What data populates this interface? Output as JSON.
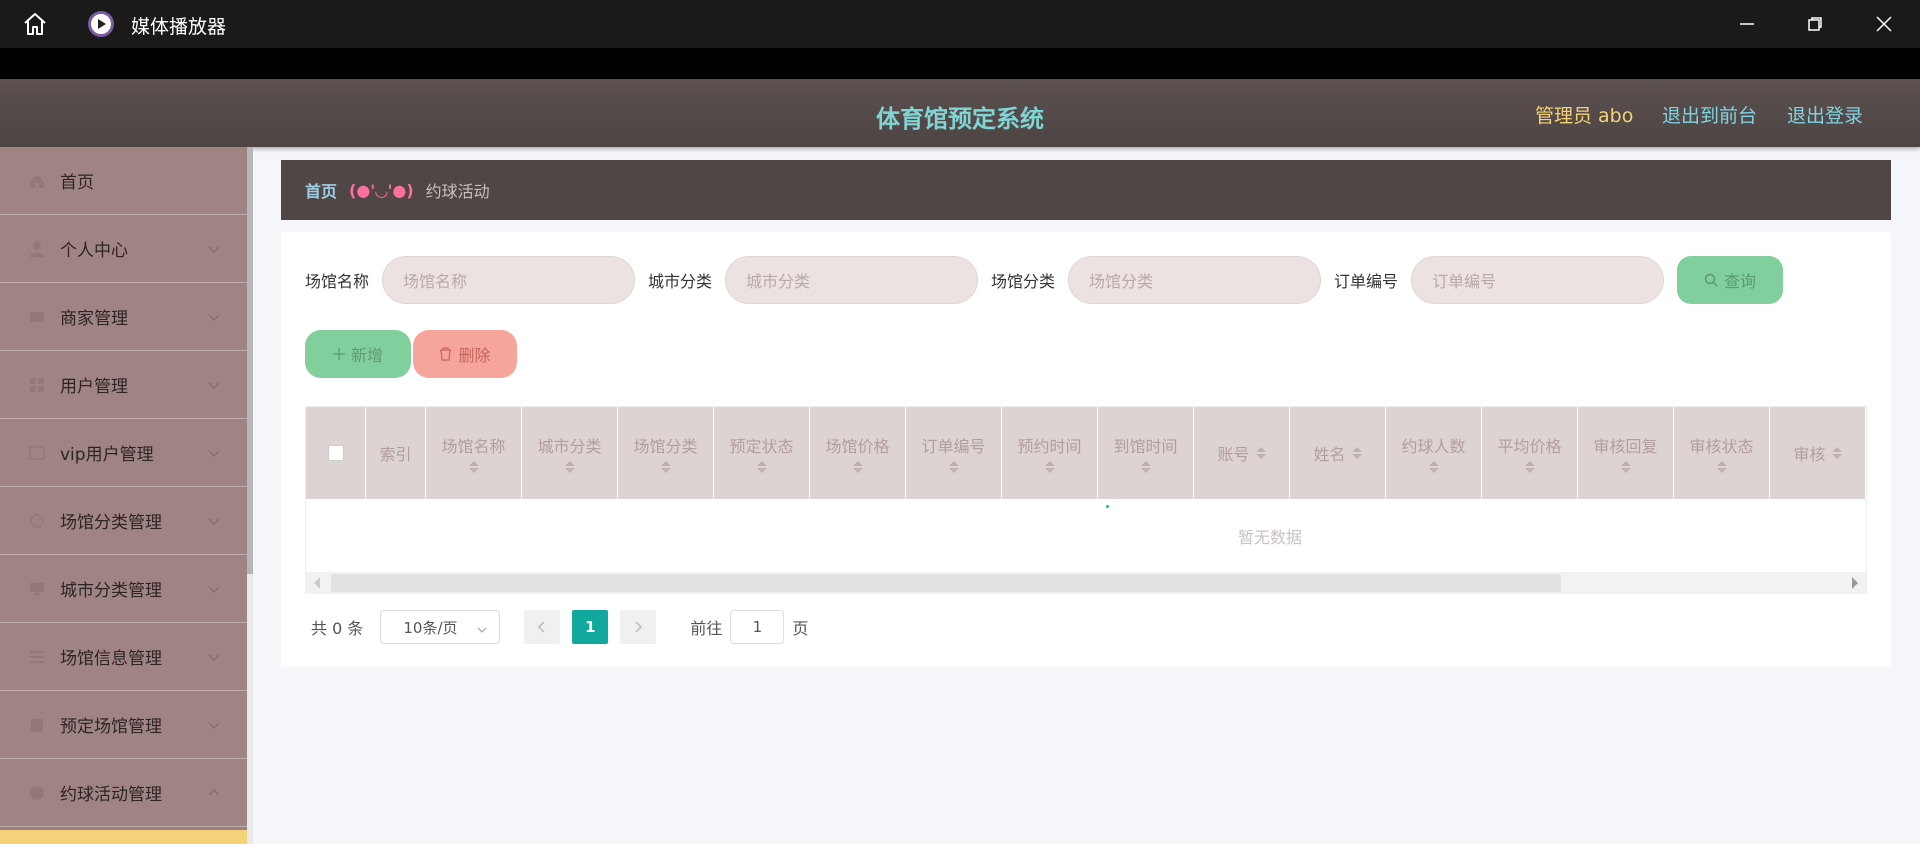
{
  "window": {
    "title": "媒体播放器",
    "icons": [
      "home-icon",
      "play-icon",
      "minimize-icon",
      "restore-icon",
      "close-icon"
    ]
  },
  "header": {
    "system_title": "体育馆预定系统",
    "admin_label": "管理员 abo",
    "front_link": "退出到前台",
    "logout_link": "退出登录"
  },
  "sidebar": {
    "items": [
      {
        "label": "首页",
        "icon": "home-icon"
      },
      {
        "label": "个人中心",
        "icon": "user-icon"
      },
      {
        "label": "商家管理",
        "icon": "store-icon"
      },
      {
        "label": "用户管理",
        "icon": "grid-icon"
      },
      {
        "label": "vip用户管理",
        "icon": "vip-icon"
      },
      {
        "label": "场馆分类管理",
        "icon": "circle-icon"
      },
      {
        "label": "城市分类管理",
        "icon": "monitor-icon"
      },
      {
        "label": "场馆信息管理",
        "icon": "list-icon"
      },
      {
        "label": "预定场馆管理",
        "icon": "calendar-icon"
      },
      {
        "label": "约球活动管理",
        "icon": "ball-icon"
      }
    ]
  },
  "breadcrumb": {
    "home": "首页",
    "face": "(●'◡'●)",
    "current": "约球活动"
  },
  "search": {
    "fields": [
      {
        "label": "场馆名称",
        "placeholder": "场馆名称"
      },
      {
        "label": "城市分类",
        "placeholder": "城市分类"
      },
      {
        "label": "场馆分类",
        "placeholder": "场馆分类"
      },
      {
        "label": "订单编号",
        "placeholder": "订单编号"
      }
    ],
    "query_button": "查询"
  },
  "actions": {
    "add_button": "新增",
    "delete_button": "删除"
  },
  "table": {
    "columns": [
      "索引",
      "场馆名称",
      "城市分类",
      "场馆分类",
      "预定状态",
      "场馆价格",
      "订单编号",
      "预约时间",
      "到馆时间",
      "账号",
      "姓名",
      "约球人数",
      "平均价格",
      "审核回复",
      "审核状态",
      "审核"
    ],
    "empty_text": "暂无数据"
  },
  "pagination": {
    "total": "共 0 条",
    "page_size": "10条/页",
    "current_page": "1",
    "goto_label": "前往",
    "goto_value": "1",
    "page_suffix": "页"
  },
  "colors": {
    "sidebar": "#a08484",
    "header": "#514646",
    "accent_teal": "#13a89e",
    "title": "#7fd4d4",
    "admin": "#f3d27a",
    "add": "#80cf9c",
    "delete": "#f6a59c"
  }
}
